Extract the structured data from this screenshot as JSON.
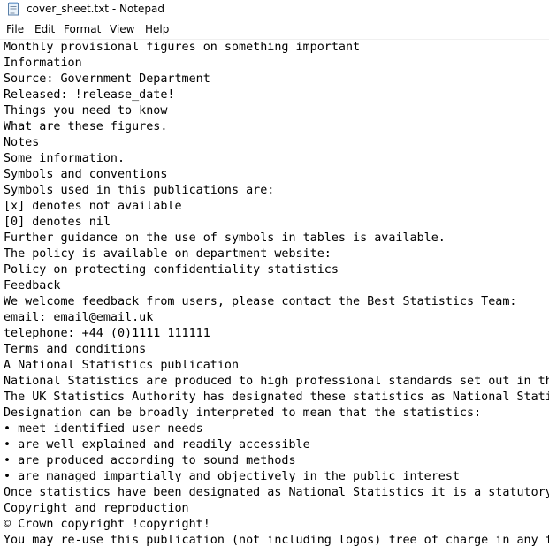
{
  "window": {
    "title": "cover_sheet.txt - Notepad",
    "icon": "notepad-icon"
  },
  "menu": {
    "items": [
      "File",
      "Edit",
      "Format",
      "View",
      "Help"
    ]
  },
  "document": {
    "lines": [
      "Monthly provisional figures on something important",
      "Information",
      "Source: Government Department",
      "Released: !release_date!",
      "Things you need to know",
      "What are these figures.",
      "Notes",
      "Some information.",
      "Symbols and conventions",
      "Symbols used in this publications are:",
      "[x] denotes not available",
      "[0] denotes nil",
      "Further guidance on the use of symbols in tables is available.",
      "The policy is available on department website:",
      "Policy on protecting confidentiality statistics",
      "Feedback",
      "We welcome feedback from users, please contact the Best Statistics Team:",
      "email: email@email.uk",
      "telephone: +44 (0)1111 111111",
      "Terms and conditions",
      "A National Statistics publication",
      "National Statistics are produced to high professional standards set out in th",
      "The UK Statistics Authority has designated these statistics as National Stati",
      "Designation can be broadly interpreted to mean that the statistics:",
      "• meet identified user needs",
      "• are well explained and readily accessible",
      "• are produced according to sound methods",
      "• are managed impartially and objectively in the public interest",
      "Once statistics have been designated as National Statistics it is a statutory",
      "Copyright and reproduction",
      "© Crown copyright !copyright!",
      "You may re-use this publication (not including logos) free of charge in any f"
    ]
  }
}
